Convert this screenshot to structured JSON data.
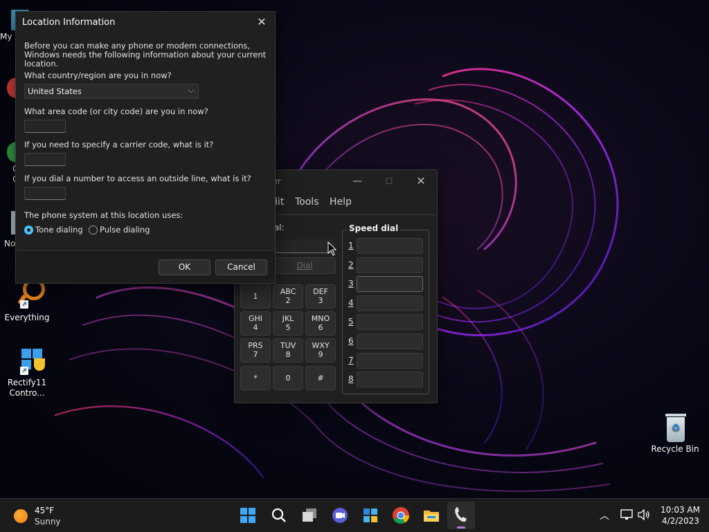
{
  "desktop": {
    "icons": [
      {
        "label": "My"
      },
      {
        "label": "C"
      },
      {
        "label": "C"
      },
      {
        "label": "No"
      },
      {
        "label": "Everything"
      },
      {
        "label": "Rectify11 Contro..."
      },
      {
        "label": "Recycle Bin"
      }
    ]
  },
  "dialer": {
    "title": "e Dialer",
    "menu": [
      "dit",
      "Tools",
      "Help"
    ],
    "number_label": "to dial:",
    "dial_label": "Dial",
    "keys": [
      {
        "letters": "",
        "digit": "1"
      },
      {
        "letters": "ABC",
        "digit": "2"
      },
      {
        "letters": "DEF",
        "digit": "3"
      },
      {
        "letters": "GHI",
        "digit": "4"
      },
      {
        "letters": "JKL",
        "digit": "5"
      },
      {
        "letters": "MNO",
        "digit": "6"
      },
      {
        "letters": "PRS",
        "digit": "7"
      },
      {
        "letters": "TUV",
        "digit": "8"
      },
      {
        "letters": "WXY",
        "digit": "9"
      },
      {
        "letters": "",
        "digit": "*"
      },
      {
        "letters": "",
        "digit": "0"
      },
      {
        "letters": "",
        "digit": "#"
      }
    ],
    "speed_dial_title": "Speed dial",
    "speed_dial_numbers": [
      "1",
      "2",
      "3",
      "4",
      "5",
      "6",
      "7",
      "8"
    ]
  },
  "location_dialog": {
    "title": "Location Information",
    "intro": "Before you can make any phone or modem connections, Windows needs the following information about your current location.",
    "q_country": "What country/region are you in now?",
    "country_value": "United States",
    "q_area": "What area code (or city code) are you in now?",
    "q_carrier": "If you need to specify a carrier code, what is it?",
    "q_outside": "If you dial a number to access an outside line, what is it?",
    "q_system": "The phone system at this location uses:",
    "tone_label": "Tone dialing",
    "pulse_label": "Pulse dialing",
    "ok_label": "OK",
    "cancel_label": "Cancel"
  },
  "taskbar": {
    "weather_temp": "45°F",
    "weather_desc": "Sunny",
    "time": "10:03 AM",
    "date": "4/2/2023"
  },
  "colors": {
    "accent": "#4cc2ff",
    "window_bg": "#202020",
    "taskbar_bg": "#1c1c1c"
  }
}
